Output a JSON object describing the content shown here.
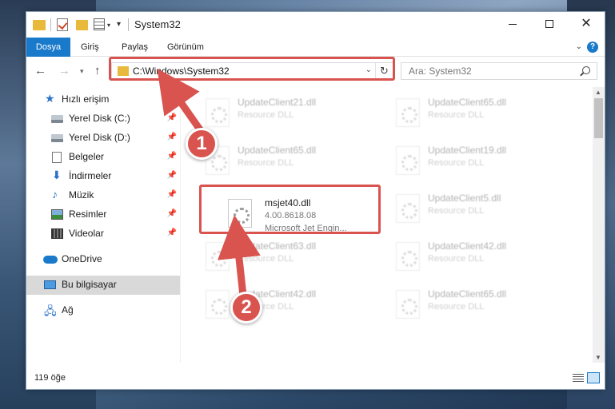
{
  "window": {
    "title": "System32",
    "controls": {
      "minimize": "minimize",
      "maximize": "maximize",
      "close": "✕"
    }
  },
  "ribbon": {
    "tabs": [
      "Dosya",
      "Giriş",
      "Paylaş",
      "Görünüm"
    ],
    "help": "?"
  },
  "navigation": {
    "address": "C:\\Windows\\System32",
    "search_placeholder": "Ara: System32"
  },
  "sidebar": {
    "items": [
      {
        "label": "Hızlı erişim",
        "icon": "star-icon"
      },
      {
        "label": "Yerel Disk (C:)",
        "icon": "drive-icon",
        "pinned": true
      },
      {
        "label": "Yerel Disk (D:)",
        "icon": "drive-icon",
        "pinned": true
      },
      {
        "label": "Belgeler",
        "icon": "documents-icon",
        "pinned": true
      },
      {
        "label": "İndirmeler",
        "icon": "download-icon",
        "pinned": true
      },
      {
        "label": "Müzik",
        "icon": "music-icon",
        "pinned": true
      },
      {
        "label": "Resimler",
        "icon": "pictures-icon",
        "pinned": true
      },
      {
        "label": "Videolar",
        "icon": "videos-icon",
        "pinned": true
      },
      {
        "label": "OneDrive",
        "icon": "onedrive-icon"
      },
      {
        "label": "Bu bilgisayar",
        "icon": "this-pc-icon",
        "selected": true
      },
      {
        "label": "Ağ",
        "icon": "network-icon"
      }
    ]
  },
  "files": [
    {
      "name": "UpdateClient21.dll",
      "type": "Resource DLL",
      "faded": true
    },
    {
      "name": "UpdateClient65.dll",
      "type": "Resource DLL",
      "faded": true
    },
    {
      "name": "UpdateClient65.dll",
      "type": "Resource DLL",
      "faded": true
    },
    {
      "name": "UpdateClient19.dll",
      "type": "Resource DLL",
      "faded": true
    },
    {
      "name": "msjet40.dll",
      "version": "4.00.8618.08",
      "description": "Microsoft Jet Engin...",
      "faded": false
    },
    {
      "name": "UpdateClient5.dll",
      "type": "Resource DLL",
      "faded": true
    },
    {
      "name": "UpdateClient63.dll",
      "type": "Resource DLL",
      "faded": true
    },
    {
      "name": "UpdateClient42.dll",
      "type": "Resource DLL",
      "faded": true
    },
    {
      "name": "UpdateClient42.dll",
      "type": "Resource DLL",
      "faded": true
    },
    {
      "name": "UpdateClient65.dll",
      "type": "Resource DLL",
      "faded": true
    }
  ],
  "status": {
    "count": "119 öğe"
  },
  "annotations": {
    "step1": "1",
    "step2": "2",
    "color": "#d9534f"
  },
  "colors": {
    "accent": "#1979ca",
    "folder": "#e8b93b",
    "highlight": "#d9534f"
  }
}
